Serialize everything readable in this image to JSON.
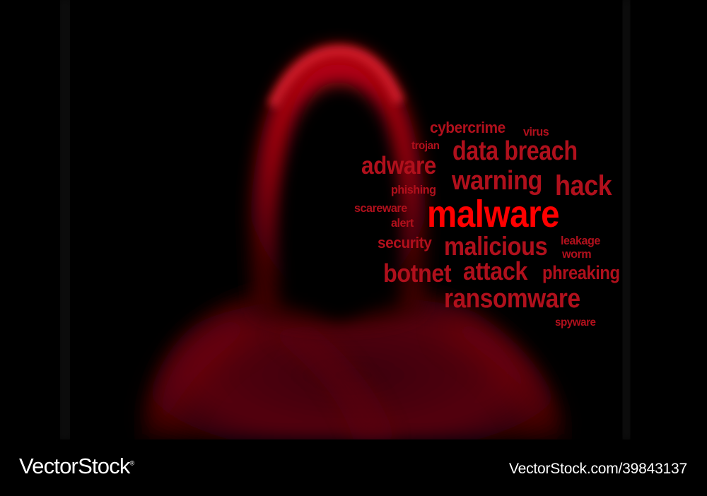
{
  "image": {
    "background_color": "#000000",
    "subject": "blurred hooded figure lit in red",
    "figure_color": "#c00018"
  },
  "word_cloud": {
    "primary_color": "#ff0000",
    "secondary_color": "#b0101c",
    "words": [
      {
        "id": "cybercrime",
        "text": "cybercrime"
      },
      {
        "id": "virus",
        "text": "virus"
      },
      {
        "id": "trojan",
        "text": "trojan"
      },
      {
        "id": "data-breach",
        "text": "data breach"
      },
      {
        "id": "adware",
        "text": "adware"
      },
      {
        "id": "warning",
        "text": "warning"
      },
      {
        "id": "hack",
        "text": "hack"
      },
      {
        "id": "phishing",
        "text": "phishing"
      },
      {
        "id": "scareware",
        "text": "scareware"
      },
      {
        "id": "malware",
        "text": "malware"
      },
      {
        "id": "alert",
        "text": "alert"
      },
      {
        "id": "security",
        "text": "security"
      },
      {
        "id": "malicious",
        "text": "malicious"
      },
      {
        "id": "leakage",
        "text": "leakage"
      },
      {
        "id": "worm",
        "text": "worm"
      },
      {
        "id": "botnet",
        "text": "botnet"
      },
      {
        "id": "attack",
        "text": "attack"
      },
      {
        "id": "phreaking",
        "text": "phreaking"
      },
      {
        "id": "ransomware",
        "text": "ransomware"
      },
      {
        "id": "spyware",
        "text": "spyware"
      }
    ]
  },
  "footer": {
    "brand": "VectorStock",
    "brand_mark": "®",
    "stock_id": "VectorStock.com/39843137"
  }
}
